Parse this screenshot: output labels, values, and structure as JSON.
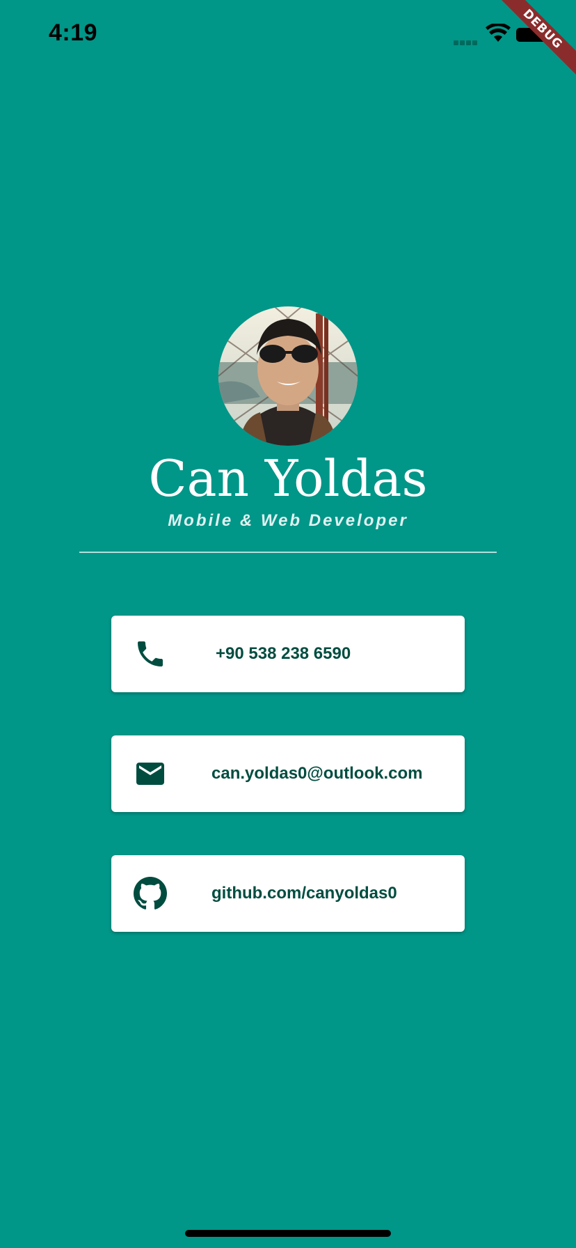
{
  "status_bar": {
    "time": "4:19"
  },
  "debug_banner": {
    "label": "DEBUG"
  },
  "profile": {
    "name": "Can Yoldas",
    "title": "Mobile & Web Developer"
  },
  "contacts": [
    {
      "icon": "phone-icon",
      "text": "+90 538 238 6590"
    },
    {
      "icon": "mail-icon",
      "text": "can.yoldas0@outlook.com"
    },
    {
      "icon": "github-icon",
      "text": "github.com/canyoldas0"
    }
  ],
  "colors": {
    "background": "#009688",
    "card_text": "#004d40",
    "icon": "#004d40",
    "card_bg": "#ffffff",
    "banner": "#8b2c2c"
  }
}
